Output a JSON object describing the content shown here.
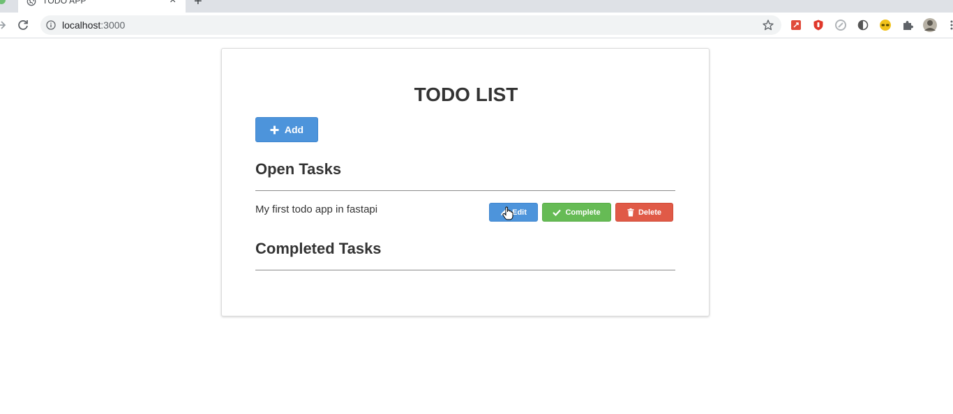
{
  "browser": {
    "tab_title": "TODO APP",
    "url_host": "localhost",
    "url_port": ":3000"
  },
  "page": {
    "title": "TODO LIST",
    "add_label": "Add",
    "open_tasks_title": "Open Tasks",
    "completed_tasks_title": "Completed Tasks",
    "open_tasks": [
      {
        "text": "My first todo app in fastapi",
        "edit_label": "Edit",
        "complete_label": "Complete",
        "delete_label": "Delete"
      }
    ],
    "completed_tasks": []
  },
  "colors": {
    "primary": "#4d94db",
    "success": "#66bb55",
    "danger": "#e05a47"
  }
}
